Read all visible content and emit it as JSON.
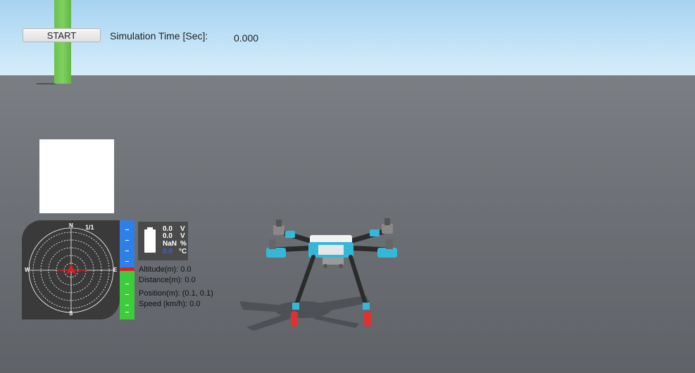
{
  "toolbar": {
    "start_label": "START",
    "sim_time_label": "Simulation Time [Sec]:",
    "sim_time_value": "0.000"
  },
  "compass": {
    "north": "N",
    "south": "S",
    "east": "E",
    "west": "W",
    "scale": "1/1",
    "icon": "aircraft-heading-icon"
  },
  "battery": {
    "icon": "battery-icon",
    "voltage1_value": "0.0",
    "voltage1_unit": "V",
    "voltage2_value": "0.0",
    "voltage2_unit": "V",
    "percent_value": "NaN",
    "percent_unit": "%",
    "temp_value": "0.0",
    "temp_unit": "°C"
  },
  "telemetry": {
    "altitude": "Altitude(m): 0.0",
    "distance": "Distance(m): 0.0",
    "position": "Position(m): (0.1, 0.1)",
    "speed": "Speed (km/h): 0.0"
  },
  "colors": {
    "sky": "#c3e3f7",
    "ground": "#6d7176",
    "pillar": "#7fd15e",
    "altitude_upper": "#2f7fe8",
    "altitude_lower": "#3ccc3c",
    "marker": "#e02020",
    "drone_frame": "#2b2b2b",
    "drone_accent": "#35b8d8",
    "landing_tip": "#e03030"
  }
}
